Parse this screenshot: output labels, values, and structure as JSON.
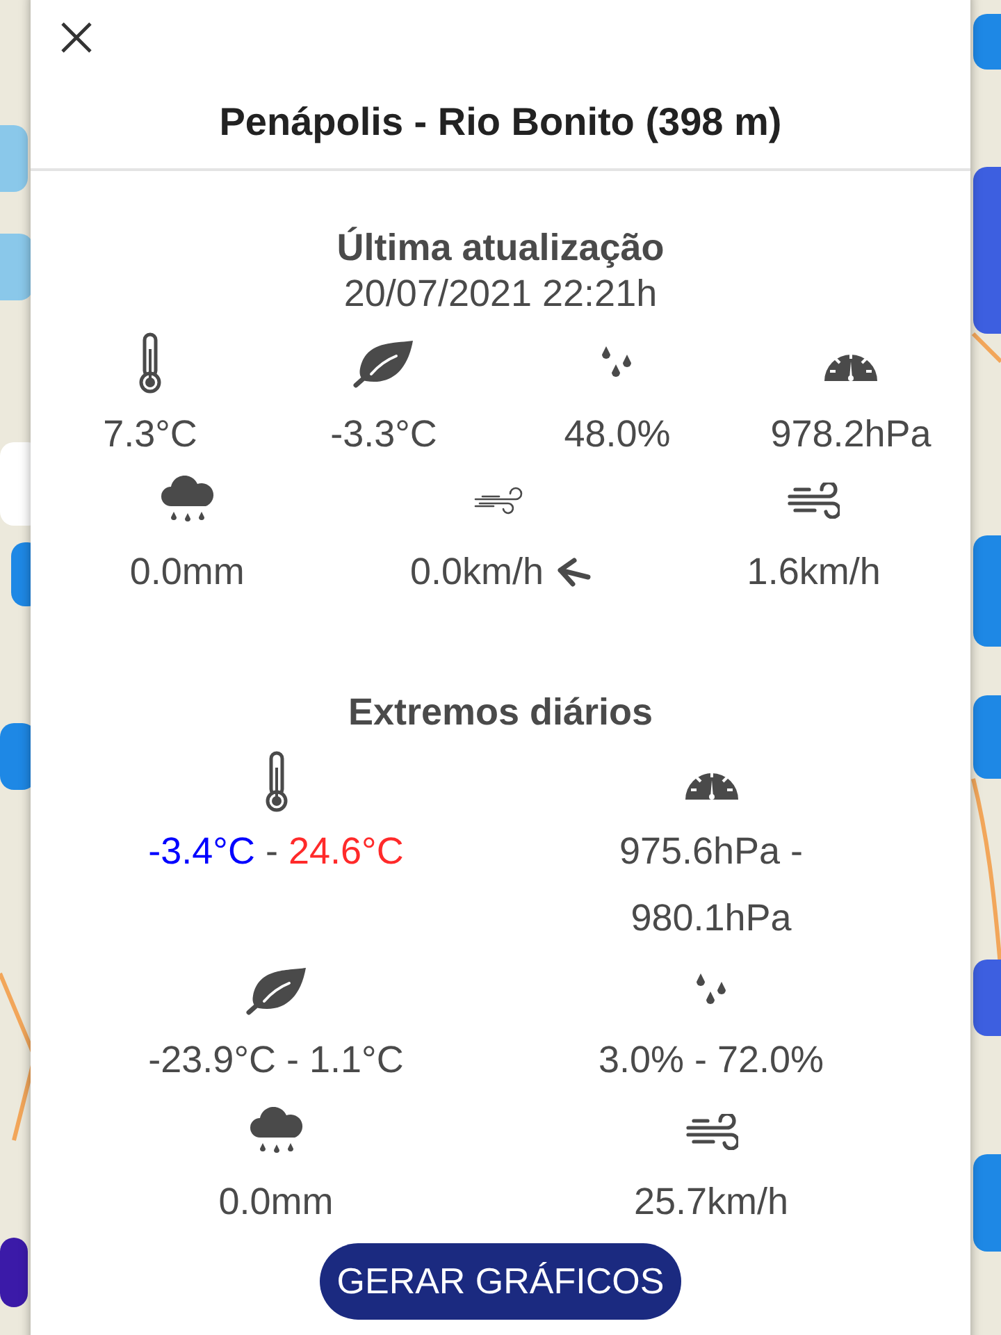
{
  "dialog": {
    "title": "Penápolis - Rio Bonito (398 m)",
    "update": {
      "heading": "Última atualização",
      "timestamp": "20/07/2021 22:21h"
    },
    "current": [
      {
        "kind": "temperature",
        "value": "7.3°C"
      },
      {
        "kind": "dewpoint",
        "value": "-3.3°C"
      },
      {
        "kind": "humidity",
        "value": "48.0%"
      },
      {
        "kind": "pressure",
        "value": "978.2hPa"
      }
    ],
    "current_row_2": [
      {
        "kind": "rain",
        "value": "0.0mm"
      },
      {
        "kind": "wind",
        "value": "0.0km/h"
      },
      {
        "kind": "gust",
        "value": "1.6km/h"
      }
    ],
    "extremes": {
      "heading": "Extremos diários",
      "items": [
        {
          "kind": "temperature",
          "parts": [
            {
              "text": "-3.4°C",
              "color": "#0000ff"
            },
            {
              "text": " - ",
              "color": "#4a4a4a"
            },
            {
              "text": "24.6°C",
              "color": "#ff2a2a"
            }
          ]
        },
        {
          "kind": "pressure",
          "parts": [
            {
              "text": "975.6hPa - 980.1hPa",
              "color": "#4a4a4a"
            }
          ]
        },
        {
          "kind": "dewpoint",
          "parts": [
            {
              "text": "-23.9°C - 1.1°C",
              "color": "#4a4a4a"
            }
          ]
        },
        {
          "kind": "humidity",
          "parts": [
            {
              "text": "3.0% - 72.0%",
              "color": "#4a4a4a"
            }
          ]
        },
        {
          "kind": "rain",
          "parts": [
            {
              "text": "0.0mm",
              "color": "#4a4a4a"
            }
          ]
        },
        {
          "kind": "gust",
          "parts": [
            {
              "text": "25.7km/h",
              "color": "#4a4a4a"
            }
          ]
        }
      ]
    },
    "button": "GERAR GRÁFICOS"
  }
}
